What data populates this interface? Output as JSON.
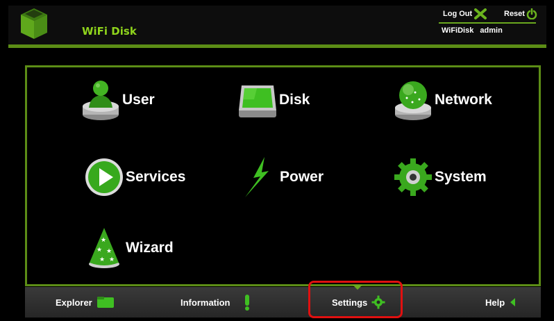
{
  "header": {
    "title": "WiFi Disk",
    "logout_label": "Log Out",
    "reset_label": "Reset",
    "device_name": "WiFiDisk",
    "username": "admin"
  },
  "tiles": [
    {
      "label": "User",
      "icon": "user-icon"
    },
    {
      "label": "Disk",
      "icon": "disk-icon"
    },
    {
      "label": "Network",
      "icon": "network-icon"
    },
    {
      "label": "Services",
      "icon": "services-icon"
    },
    {
      "label": "Power",
      "icon": "power-icon"
    },
    {
      "label": "System",
      "icon": "system-icon"
    },
    {
      "label": "Wizard",
      "icon": "wizard-icon"
    }
  ],
  "bottom_nav": {
    "explorer_label": "Explorer",
    "information_label": "Information",
    "settings_label": "Settings",
    "help_label": "Help",
    "active": "Settings"
  },
  "colors": {
    "accent": "#8fd41c",
    "border": "#5c8d16",
    "highlight": "#e01010"
  }
}
